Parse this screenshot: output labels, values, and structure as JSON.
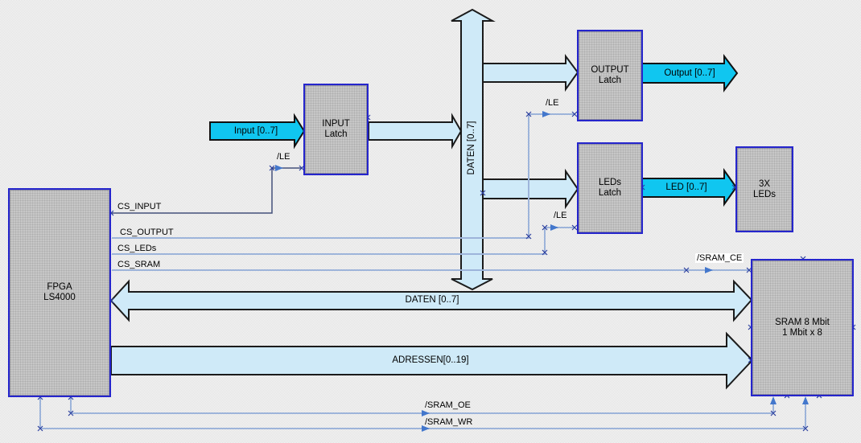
{
  "diagram": {
    "blocks": {
      "fpga": {
        "line1": "FPGA",
        "line2": "LS4000"
      },
      "input_latch": {
        "line1": "INPUT",
        "line2": "Latch"
      },
      "output_latch": {
        "line1": "OUTPUT",
        "line2": "Latch"
      },
      "leds_latch": {
        "line1": "LEDs",
        "line2": "Latch"
      },
      "leds_3x": {
        "line1": "3X",
        "line2": "LEDs"
      },
      "sram": {
        "line1": "SRAM 8 Mbit",
        "line2": "1 Mbit x 8"
      }
    },
    "bus_labels": {
      "input": "Input [0..7]",
      "output": "Output [0..7]",
      "led": "LED [0..7]",
      "daten_vertical": "DATEN [0..7]",
      "daten_horizontal": "DATEN [0..7]",
      "adressen": "ADRESSEN[0..19]"
    },
    "signal_labels": {
      "cs_input": "CS_INPUT",
      "cs_output": "CS_OUTPUT",
      "cs_leds": "CS_LEDs",
      "cs_sram": "CS_SRAM",
      "le_input": "/LE",
      "le_output": "/LE",
      "le_leds": "/LE",
      "sram_ce": "/SRAM_CE",
      "sram_oe": "/SRAM_OE",
      "sram_wr": "/SRAM_WR"
    },
    "colors": {
      "bus_fill": "#cfeaf8",
      "cyan_fill": "#10c6f0",
      "block_fill": "#c7c7c7",
      "block_border": "#2525cc",
      "line_light": "#9db4da",
      "line_dark": "#44507a",
      "arrowhead": "#4377cc",
      "junction": "#2b3f9e",
      "arrow_outline": "#1b1b1b"
    }
  }
}
